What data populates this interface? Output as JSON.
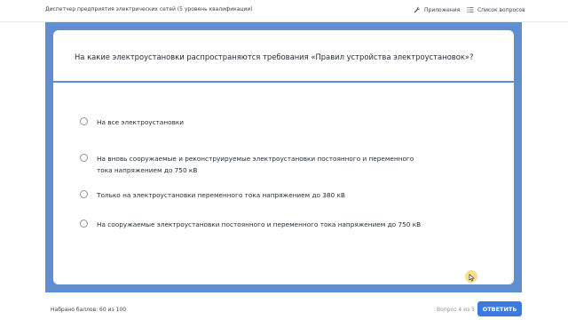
{
  "header": {
    "app_title": "Диспетчер предприятия электрических сетей (5 уровень квалификации)",
    "apps_label": "Приложения",
    "apps_icon": "wrench-icon",
    "questions_label": "Список вопросов",
    "questions_icon": "list-icon"
  },
  "question": {
    "text": "На какие электроустановки распространяются требования «Правил устройства электроустановок»?",
    "options": [
      {
        "label": "На все электроустановки",
        "selected": false
      },
      {
        "label": "На вновь сооружаемые и реконструируемые электроустановки постоянного и переменного тока напряжением до 750 кВ",
        "selected": false
      },
      {
        "label": "Только на электроустановки переменного тока напряжением до 380 кВ",
        "selected": false
      },
      {
        "label": "На сооружаемые электроустановки постоянного и переменного тока напряжением до 750 кВ",
        "selected": false
      }
    ]
  },
  "footer": {
    "score": "Набрано баллов: 60 из 100",
    "progress": "Вопрос 4 из 5",
    "answer_button": "ОТВЕТИТЬ"
  },
  "colors": {
    "stage_blue": "#5f8fd1",
    "button_blue": "#3b7be0",
    "cursor_highlight": "#f6d663"
  }
}
